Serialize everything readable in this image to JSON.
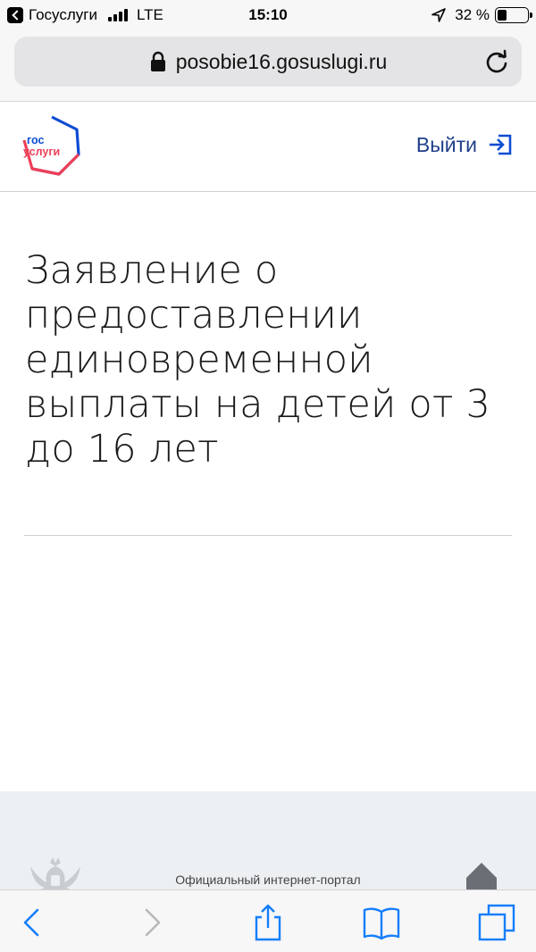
{
  "status_bar": {
    "back_app": "Госуслуги",
    "network": "LTE",
    "time": "15:10",
    "battery": "32 %",
    "battery_level": 0.32
  },
  "browser": {
    "url": "posobie16.gosuslugi.ru"
  },
  "header": {
    "logo_line1": "гос",
    "logo_line2": "услуги",
    "logout_label": "Выйти"
  },
  "main": {
    "title": "Заявление о предоставлении единовременной выплаты на детей от 3 до 16 лет"
  },
  "footer": {
    "text": "Официальный интернет-портал"
  },
  "colors": {
    "accent_blue": "#0d4cd3",
    "logo_red": "#ee3f58",
    "ios_blue": "#147efb",
    "footer_bg": "#edf0f3"
  }
}
